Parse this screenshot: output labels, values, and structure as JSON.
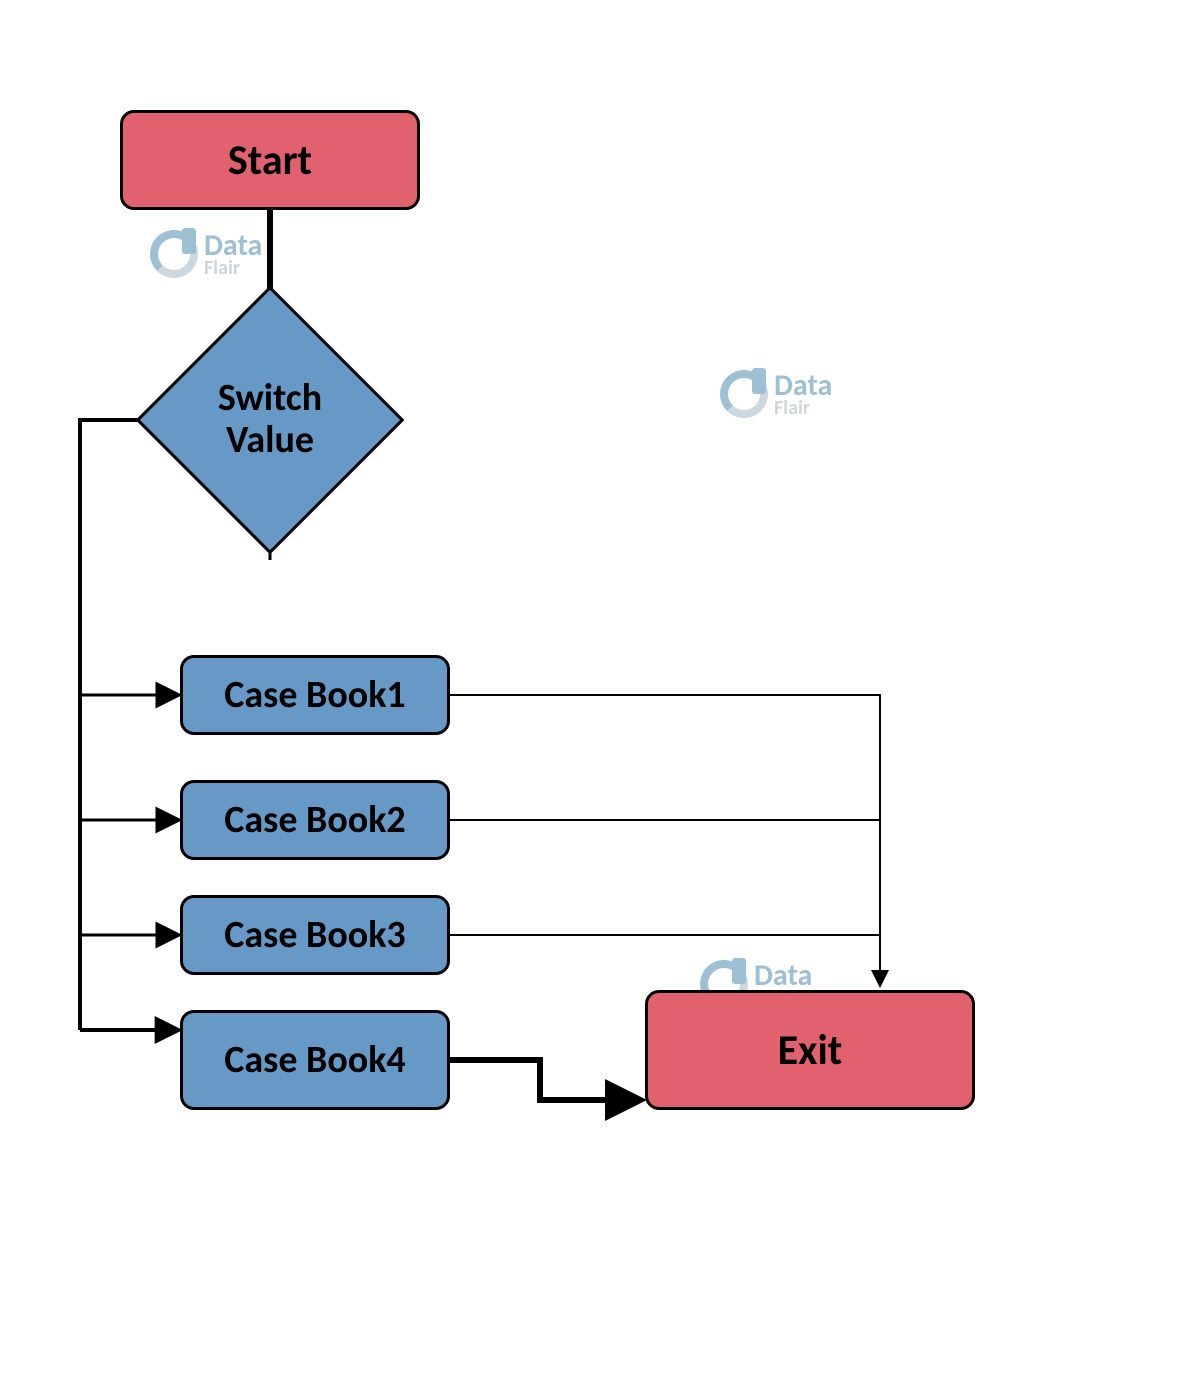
{
  "nodes": {
    "start": "Start",
    "decision": "Switch\nValue",
    "case1": "Case Book1",
    "case2": "Case Book2",
    "case3": "Case Book3",
    "case4": "Case Book4",
    "exit": "Exit"
  },
  "watermark": {
    "line1": "Data",
    "line2": "Flair"
  },
  "colors": {
    "terminal": "#e1616e",
    "process": "#6699c6",
    "stroke": "#000000"
  }
}
